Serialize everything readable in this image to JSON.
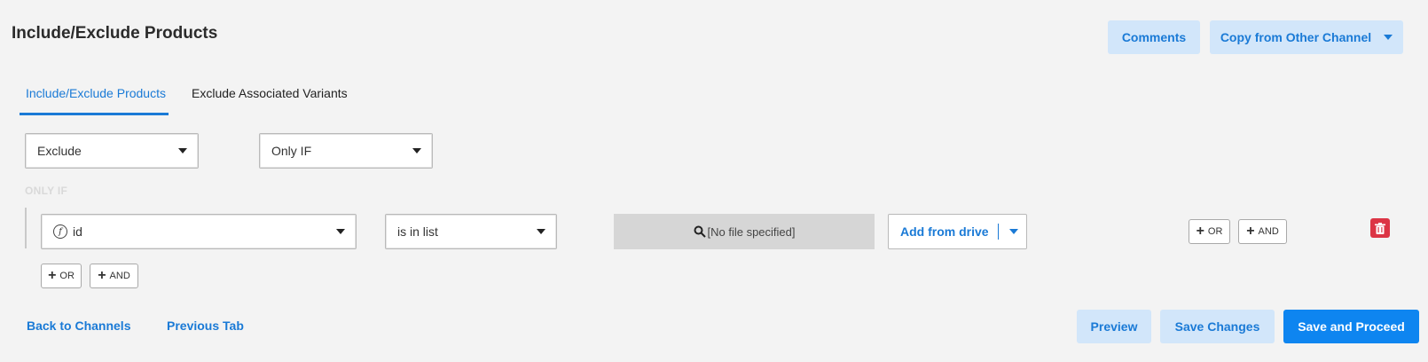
{
  "page": {
    "title": "Include/Exclude Products"
  },
  "header_buttons": {
    "comments": "Comments",
    "copy_channel": "Copy from Other Channel"
  },
  "tabs": [
    {
      "label": "Include/Exclude Products",
      "active": true
    },
    {
      "label": "Exclude Associated Variants",
      "active": false
    }
  ],
  "filters": {
    "mode": "Exclude",
    "condition": "Only IF"
  },
  "rule": {
    "section_label": "ONLY IF",
    "field": "id",
    "operator": "is in list",
    "file_placeholder": "[No file specified]",
    "add_from_drive": "Add from drive",
    "or_label": "OR",
    "and_label": "AND"
  },
  "group_buttons": {
    "or_label": "OR",
    "and_label": "AND"
  },
  "footer": {
    "back": "Back to Channels",
    "previous": "Previous Tab",
    "preview": "Preview",
    "save": "Save Changes",
    "save_proceed": "Save and Proceed"
  },
  "colors": {
    "accent": "#1a7ad6",
    "primary": "#0e85f0",
    "light_button": "#d2e6fa",
    "delete": "#dc3545"
  },
  "icons": [
    "chevron-down-icon",
    "search-icon",
    "function-icon",
    "plus-icon",
    "trash-icon"
  ]
}
